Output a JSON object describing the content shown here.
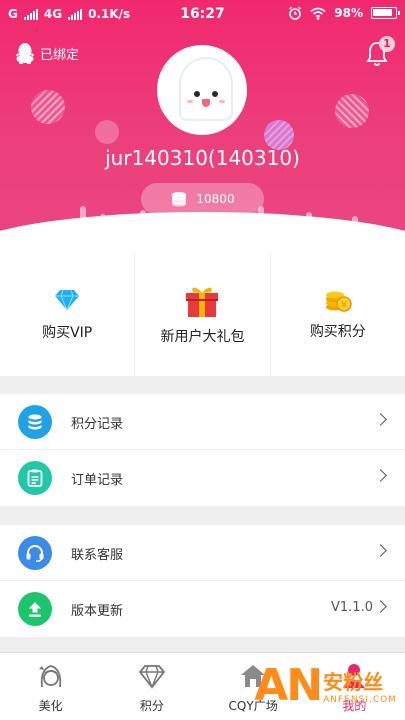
{
  "status_bar": {
    "carriers": [
      "G",
      "4G"
    ],
    "speed": "0.1K/s",
    "time": "16:27",
    "battery": "98%"
  },
  "header": {
    "qq_status": "已绑定",
    "notification_count": "1",
    "username": "jur140310(140310)",
    "points": "10800"
  },
  "quick_actions": [
    {
      "label": "购买VIP",
      "icon": "diamond-icon"
    },
    {
      "label": "新用户大礼包",
      "icon": "gift-icon"
    },
    {
      "label": "购买积分",
      "icon": "coins-icon"
    }
  ],
  "menu_group_1": [
    {
      "label": "积分记录",
      "icon": "database-icon",
      "color": "#1fa3e6"
    },
    {
      "label": "订单记录",
      "icon": "clipboard-icon",
      "color": "#22c7a8"
    }
  ],
  "menu_group_2": [
    {
      "label": "联系客服",
      "icon": "headset-icon",
      "color": "#3c8be8"
    },
    {
      "label": "版本更新",
      "icon": "upload-icon",
      "color": "#1ec46c",
      "value": "V1.1.0"
    }
  ],
  "bottom_nav": [
    {
      "label": "美化",
      "icon": "girl-face-icon"
    },
    {
      "label": "积分",
      "icon": "diamond-outline-icon"
    },
    {
      "label": "CQY广场",
      "icon": "home-icon"
    },
    {
      "label": "我的",
      "icon": "user-icon",
      "active": true
    }
  ],
  "watermark": {
    "logo": "AN",
    "name": "安粉丝",
    "domain": "ANFENSI.COM"
  },
  "colors": {
    "brand_pink": "#ec3f7c",
    "accent_red": "#e5286a"
  }
}
